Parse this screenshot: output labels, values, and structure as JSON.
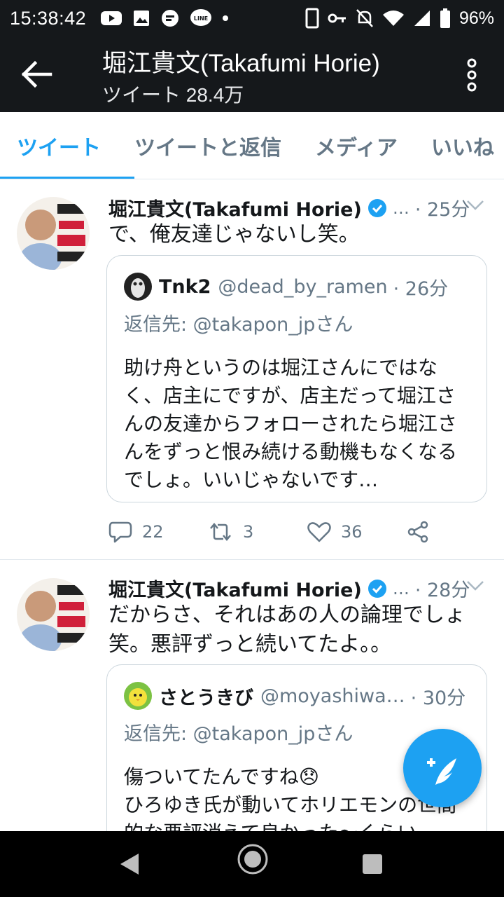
{
  "status_bar": {
    "time": "15:38:42",
    "battery": "96%"
  },
  "header": {
    "title": "堀江貴文(Takafumi Horie)",
    "subtitle": "ツイート 28.4万"
  },
  "tabs": [
    {
      "label": "ツイート"
    },
    {
      "label": "ツイートと返信"
    },
    {
      "label": "メディア"
    },
    {
      "label": "いいね"
    }
  ],
  "tweets": [
    {
      "name": "堀江貴文(Takafumi Horie)",
      "ellipsis": "…",
      "time": "· 25分",
      "text": "で、俺友達じゃないし笑。",
      "quote": {
        "name": "Tnk2",
        "handle": "@dead_by_ramen",
        "time": "· 26分",
        "reply_to": "返信先: @takapon_jpさん",
        "text": "助け舟というのは堀江さんにではなく、店主にですが、店主だって堀江さんの友達からフォローされたら堀江さんをずっと恨み続ける動機もなくなるでしょ。いいじゃないです…"
      },
      "replies": "22",
      "retweets": "3",
      "likes": "36"
    },
    {
      "name": "堀江貴文(Takafumi Horie)",
      "ellipsis": "…",
      "time": "· 28分",
      "text": "だからさ、それはあの人の論理でしょ笑。悪評ずっと続いてたよ。。",
      "quote": {
        "name": "さとうきび",
        "handle": "@moyashiwa…",
        "time": "· 30分",
        "reply_to": "返信先: @takapon_jpさん",
        "text": "傷ついてたんですね😞\nひろゆき氏が動いてホリエモンの世間的な悪評消えて良かった〜くらい"
      }
    }
  ],
  "colors": {
    "accent": "#1da1f2",
    "header_bg": "#15181b",
    "muted": "#657786"
  }
}
